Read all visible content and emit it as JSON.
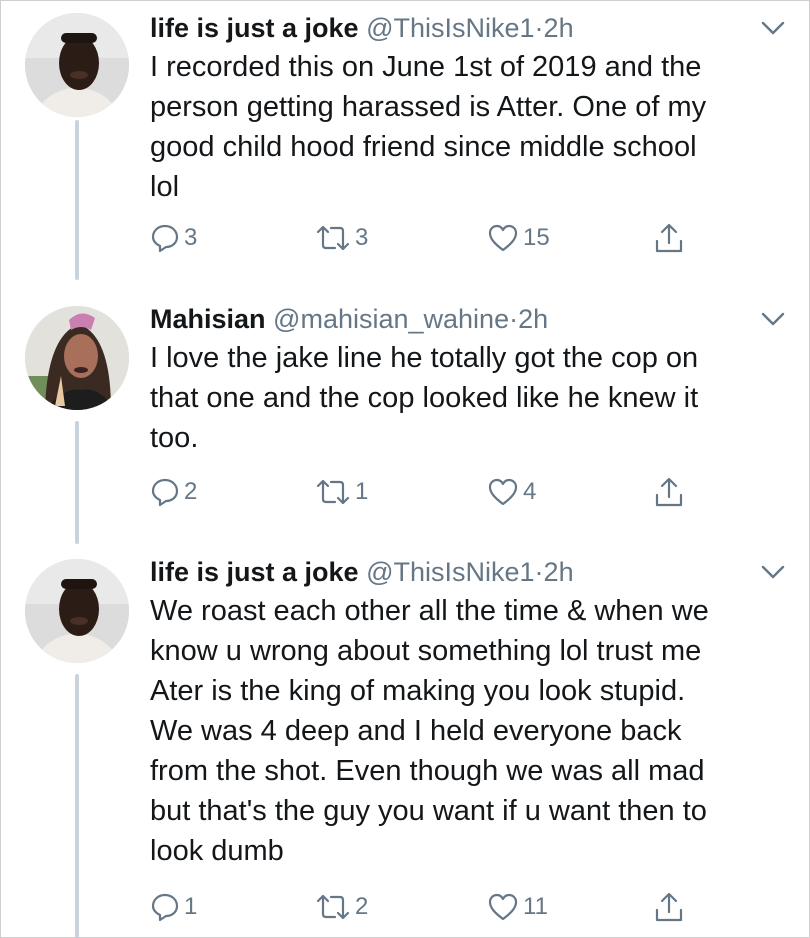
{
  "tweets": [
    {
      "name": "life is just a joke",
      "handle": "@ThisIsNike1",
      "dot": "·",
      "time": "2h",
      "text_lines": [
        "I recorded this on June 1st of 2019 and the",
        "person getting harassed is Atter. One of my",
        "good child hood friend since middle school",
        "lol"
      ],
      "replies": "3",
      "retweets": "3",
      "likes": "15"
    },
    {
      "name": "Mahisian",
      "handle": "@mahisian_wahine",
      "dot": "·",
      "time": "2h",
      "text_lines": [
        "I love the jake line he totally got the cop on",
        "that one and the cop looked like he knew it",
        "too."
      ],
      "replies": "2",
      "retweets": "1",
      "likes": "4"
    },
    {
      "name": "life is just a joke",
      "handle": "@ThisIsNike1",
      "dot": "·",
      "time": "2h",
      "text_lines": [
        "We roast each other all the time & when we",
        "know u wrong about something lol trust me",
        "Ater is the king of making you look stupid.",
        "We was 4 deep and I held everyone back",
        "from the shot. Even though we was all mad",
        "but that's the guy you want if u want then to",
        "look dumb"
      ],
      "replies": "1",
      "retweets": "2",
      "likes": "11"
    }
  ],
  "icons": {
    "reply": "reply-icon",
    "retweet": "retweet-icon",
    "like": "like-icon",
    "share": "share-icon",
    "menu": "chevron-down-icon"
  },
  "colors": {
    "text": "#14171a",
    "muted": "#657786",
    "thread_line": "#c9d3db"
  }
}
